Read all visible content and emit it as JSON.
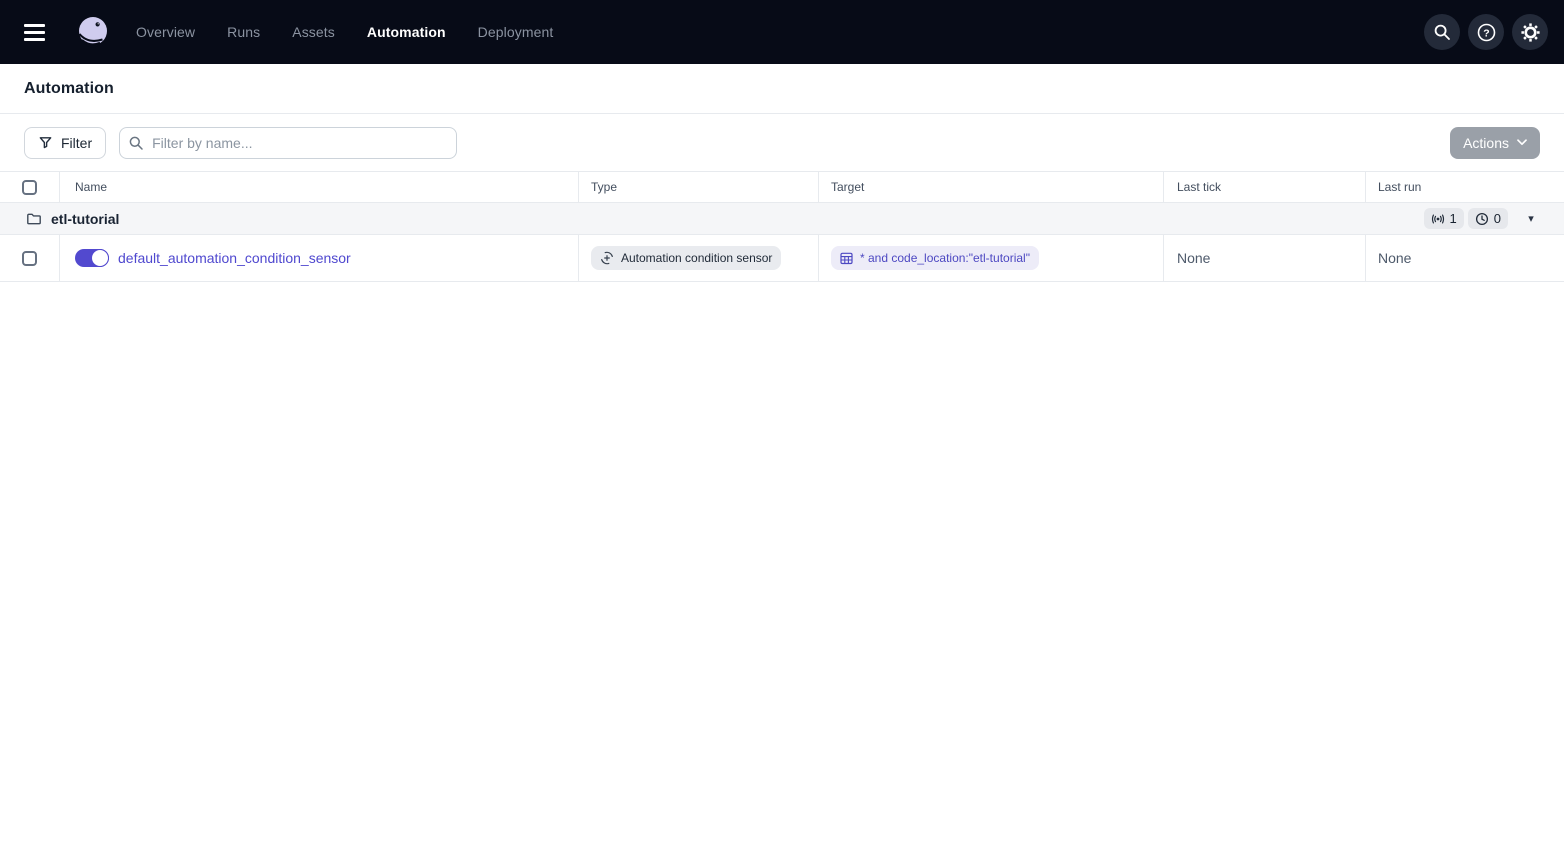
{
  "nav": {
    "items": [
      {
        "label": "Overview",
        "active": false
      },
      {
        "label": "Runs",
        "active": false
      },
      {
        "label": "Assets",
        "active": false
      },
      {
        "label": "Automation",
        "active": true
      },
      {
        "label": "Deployment",
        "active": false
      }
    ]
  },
  "page": {
    "title": "Automation"
  },
  "toolbar": {
    "filter_label": "Filter",
    "search_placeholder": "Filter by name...",
    "search_value": "",
    "actions_label": "Actions",
    "actions_disabled": true
  },
  "table": {
    "columns": [
      "Name",
      "Type",
      "Target",
      "Last tick",
      "Last run"
    ],
    "group": {
      "name": "etl-tutorial",
      "sensor_count": "1",
      "schedule_count": "0"
    },
    "rows": [
      {
        "name": "default_automation_condition_sensor",
        "enabled": true,
        "type": "Automation condition sensor",
        "target": "* and code_location:\"etl-tutorial\"",
        "last_tick": "None",
        "last_run": "None"
      }
    ]
  },
  "colors": {
    "accent_blurple": "#5249cf",
    "navbar_bg": "#070b17",
    "actions_disabled_gray": "#9aa0a8",
    "group_row_bg": "#f5f6f8",
    "tag_indigo_bg": "#edecf8",
    "tag_gray_bg": "#e9ebef"
  }
}
